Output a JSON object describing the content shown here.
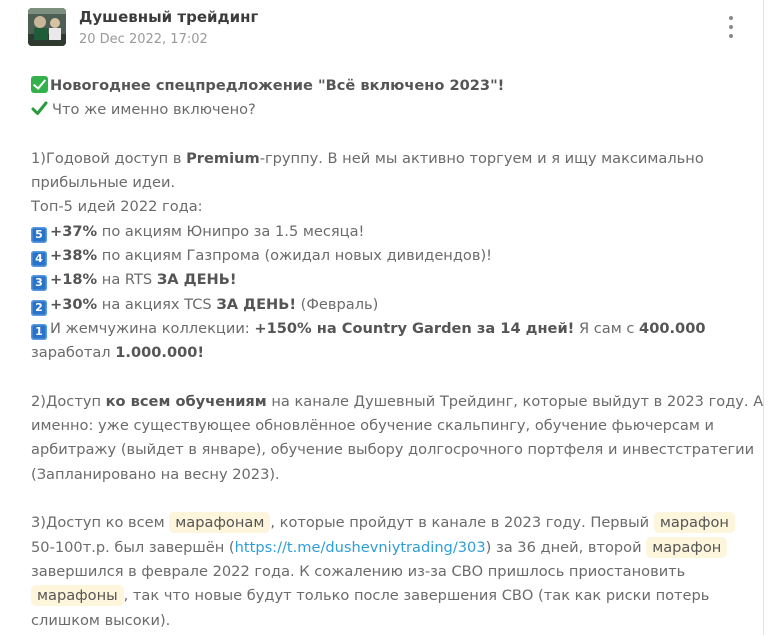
{
  "post": {
    "channel_name": "Душевный трейдинг",
    "date": "20 Dec 2022, 17:02",
    "avatar_icon": "avatar-image",
    "menu_icon": "more-vertical-icon"
  },
  "text": {
    "title": "Новогоднее спецпредложение \"Всё включено 2023\"!",
    "subtitle": "Что же именно включено?",
    "p1_a": "1)Годовой доступ в ",
    "p1_b": "Premium",
    "p1_c": "-группу. В ней мы активно торгуем и я ищу максимально",
    "p1_d": "прибыльные идеи.",
    "top5": "Топ-5 идей 2022 года:",
    "i5_key": "5",
    "i5_a": "+37%",
    "i5_b": " по акциям Юнипро за 1.5 месяца!",
    "i4_key": "4",
    "i4_a": "+38%",
    "i4_b": " по акциям Газпрома (ожидал новых дивидендов)!",
    "i3_key": "3",
    "i3_a": "+18%",
    "i3_b": " на RTS ",
    "i3_c": "ЗА ДЕНЬ!",
    "i2_key": "2",
    "i2_a": "+30%",
    "i2_b": " на акциях TCS ",
    "i2_c": "ЗА ДЕНЬ!",
    "i2_d": " (Февраль)",
    "i1_key": "1",
    "i1_a": "И жемчужина коллекции: ",
    "i1_b": "+150% на Country Garden за 14 дней!",
    "i1_c": " Я сам с ",
    "i1_d": "400.000",
    "i1_e": "заработал ",
    "i1_f": "1.000.000!",
    "p2_a": "2)Доступ ",
    "p2_b": "ко всем обучениям",
    "p2_c": " на канале Душевный Трейдинг, которые выйдут в 2023 году. А",
    "p2_d": "именно: уже существующее обновлённое обучение скальпингу, обучение фьючерсам и",
    "p2_e": "арбитражу (выйдет в январе), обучение выбору долгосрочного портфеля и инвестстратегии",
    "p2_f": "(Запланировано на весну 2023).",
    "p3_a": "3)Доступ ко всем ",
    "p3_hl1": "марафонам",
    "p3_b": ", которые пройдут в канале в 2023 году. Первый ",
    "p3_hl2": "марафон",
    "p3_c": "50-100т.р. был завершён (",
    "p3_link": "https://t.me/dushevniytrading/303",
    "p3_d": ") за 36 дней, второй ",
    "p3_hl3": "марафон",
    "p3_e": "завершился в феврале 2022 года. К сожалению из-за СВО пришлось приостановить",
    "p3_hl4": "марафоны",
    "p3_f": ", так что новые будут только после завершения СВО (так как риски потерь",
    "p3_g": "слишком высоки)."
  }
}
